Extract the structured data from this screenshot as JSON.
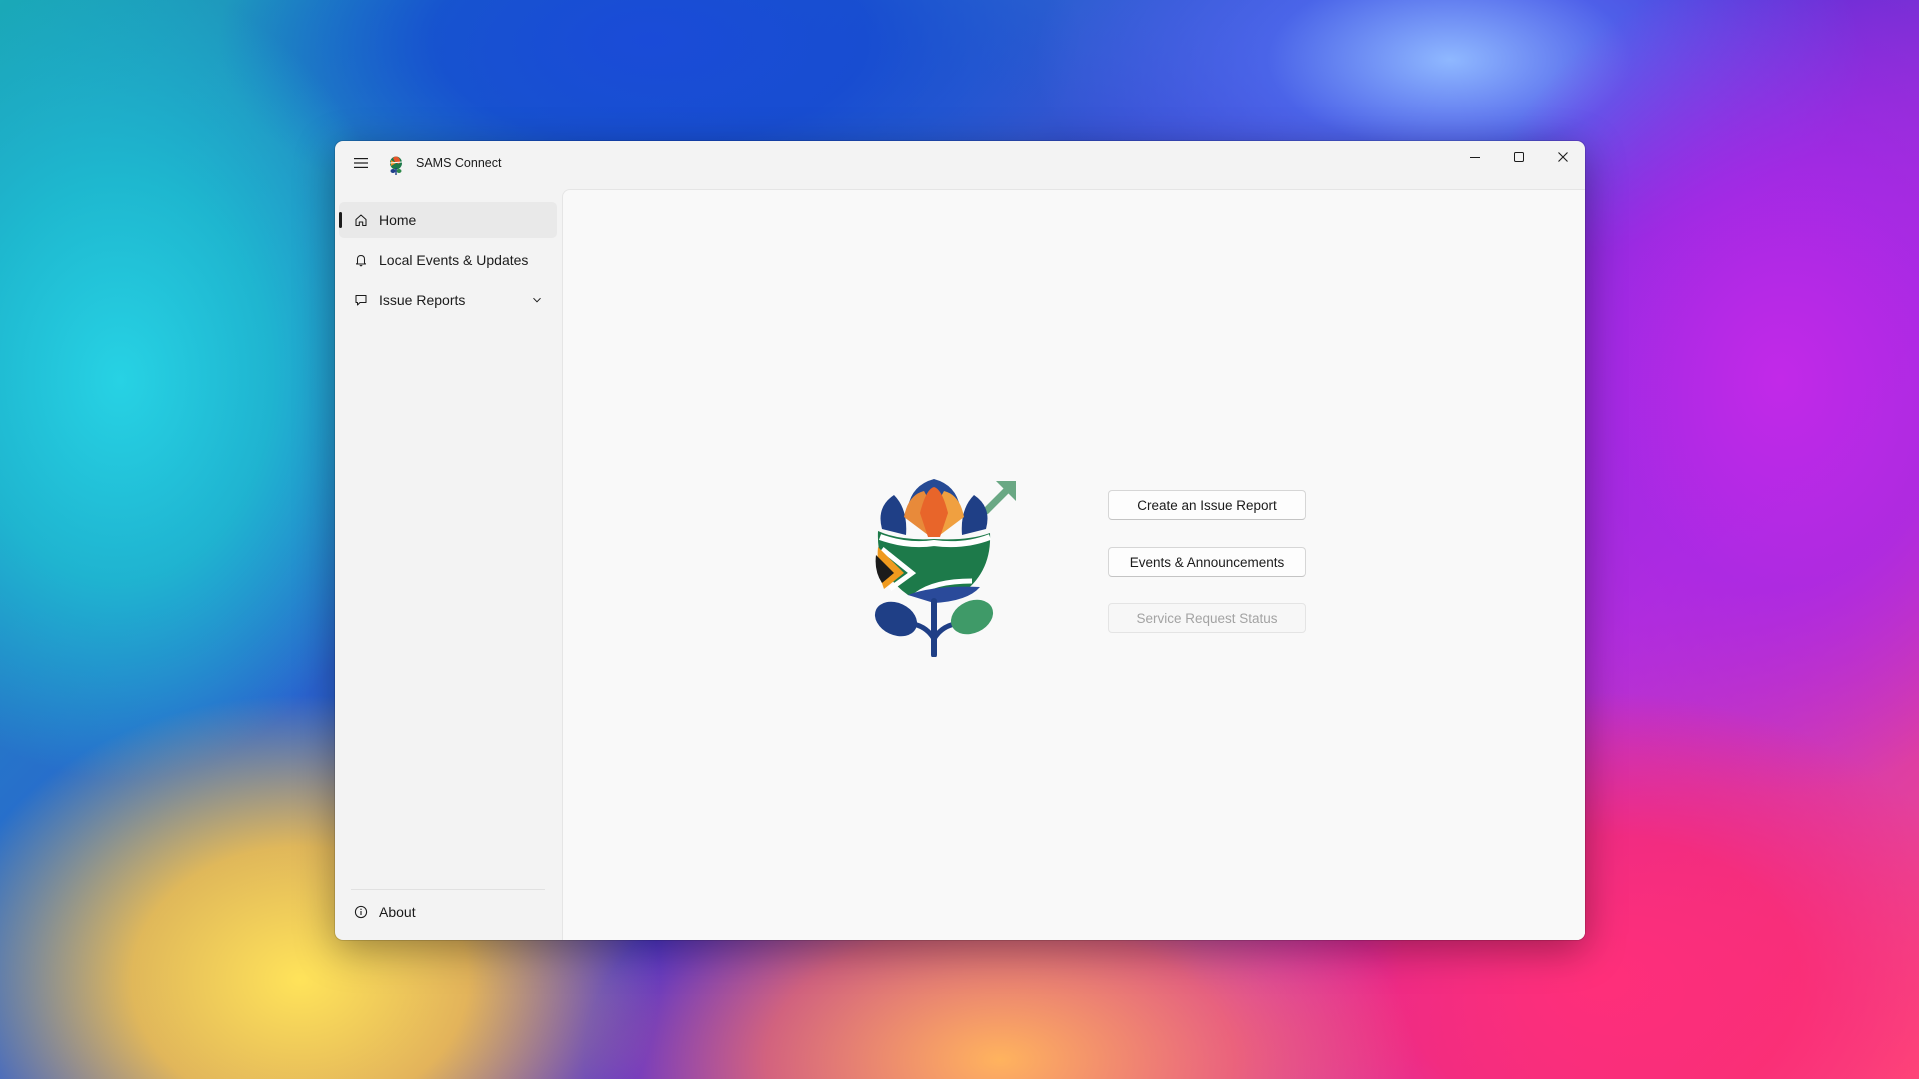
{
  "window": {
    "title": "SAMS Connect",
    "controls": [
      "minimize",
      "maximize",
      "close"
    ]
  },
  "sidebar": {
    "items": [
      {
        "label": "Home",
        "icon": "home-icon",
        "selected": true
      },
      {
        "label": "Local Events & Updates",
        "icon": "bell-icon",
        "selected": false
      },
      {
        "label": "Issue Reports",
        "icon": "comment-icon",
        "selected": false,
        "expandable": true
      }
    ],
    "footer": {
      "label": "About",
      "icon": "info-icon"
    }
  },
  "main": {
    "logo": "protea-flag-logo",
    "buttons": [
      {
        "label": "Create an Issue Report",
        "enabled": true
      },
      {
        "label": "Events & Announcements",
        "enabled": true
      },
      {
        "label": "Service Request Status",
        "enabled": false
      }
    ]
  },
  "colors": {
    "window_bg": "#f3f3f3",
    "content_bg": "#f9f9f9",
    "selected_item_bg": "#e9e9e9",
    "text": "#1b1b1b",
    "disabled_text": "#a3a3a3"
  }
}
